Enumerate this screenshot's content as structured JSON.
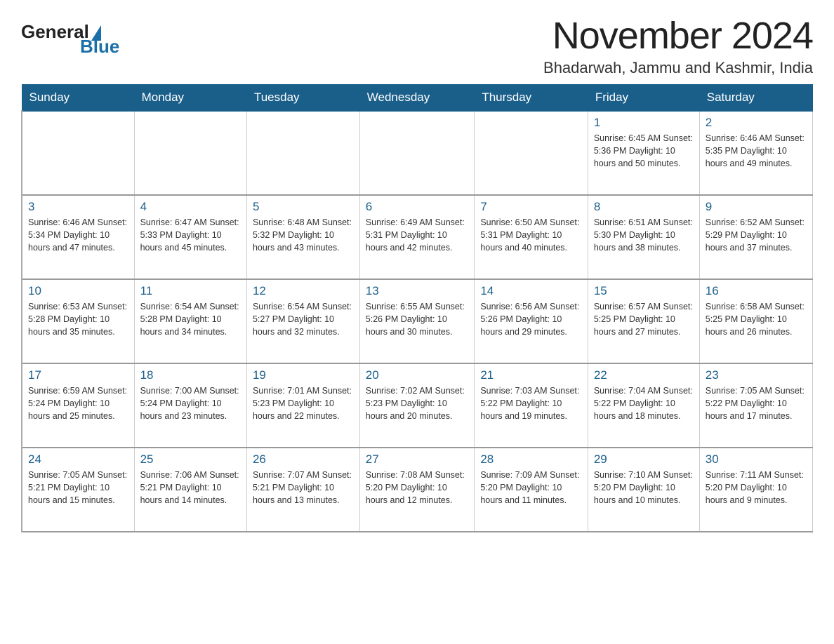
{
  "logo": {
    "general": "General",
    "blue": "Blue"
  },
  "header": {
    "month": "November 2024",
    "location": "Bhadarwah, Jammu and Kashmir, India"
  },
  "days_of_week": [
    "Sunday",
    "Monday",
    "Tuesday",
    "Wednesday",
    "Thursday",
    "Friday",
    "Saturday"
  ],
  "weeks": [
    [
      {
        "day": "",
        "info": ""
      },
      {
        "day": "",
        "info": ""
      },
      {
        "day": "",
        "info": ""
      },
      {
        "day": "",
        "info": ""
      },
      {
        "day": "",
        "info": ""
      },
      {
        "day": "1",
        "info": "Sunrise: 6:45 AM\nSunset: 5:36 PM\nDaylight: 10 hours and 50 minutes."
      },
      {
        "day": "2",
        "info": "Sunrise: 6:46 AM\nSunset: 5:35 PM\nDaylight: 10 hours and 49 minutes."
      }
    ],
    [
      {
        "day": "3",
        "info": "Sunrise: 6:46 AM\nSunset: 5:34 PM\nDaylight: 10 hours and 47 minutes."
      },
      {
        "day": "4",
        "info": "Sunrise: 6:47 AM\nSunset: 5:33 PM\nDaylight: 10 hours and 45 minutes."
      },
      {
        "day": "5",
        "info": "Sunrise: 6:48 AM\nSunset: 5:32 PM\nDaylight: 10 hours and 43 minutes."
      },
      {
        "day": "6",
        "info": "Sunrise: 6:49 AM\nSunset: 5:31 PM\nDaylight: 10 hours and 42 minutes."
      },
      {
        "day": "7",
        "info": "Sunrise: 6:50 AM\nSunset: 5:31 PM\nDaylight: 10 hours and 40 minutes."
      },
      {
        "day": "8",
        "info": "Sunrise: 6:51 AM\nSunset: 5:30 PM\nDaylight: 10 hours and 38 minutes."
      },
      {
        "day": "9",
        "info": "Sunrise: 6:52 AM\nSunset: 5:29 PM\nDaylight: 10 hours and 37 minutes."
      }
    ],
    [
      {
        "day": "10",
        "info": "Sunrise: 6:53 AM\nSunset: 5:28 PM\nDaylight: 10 hours and 35 minutes."
      },
      {
        "day": "11",
        "info": "Sunrise: 6:54 AM\nSunset: 5:28 PM\nDaylight: 10 hours and 34 minutes."
      },
      {
        "day": "12",
        "info": "Sunrise: 6:54 AM\nSunset: 5:27 PM\nDaylight: 10 hours and 32 minutes."
      },
      {
        "day": "13",
        "info": "Sunrise: 6:55 AM\nSunset: 5:26 PM\nDaylight: 10 hours and 30 minutes."
      },
      {
        "day": "14",
        "info": "Sunrise: 6:56 AM\nSunset: 5:26 PM\nDaylight: 10 hours and 29 minutes."
      },
      {
        "day": "15",
        "info": "Sunrise: 6:57 AM\nSunset: 5:25 PM\nDaylight: 10 hours and 27 minutes."
      },
      {
        "day": "16",
        "info": "Sunrise: 6:58 AM\nSunset: 5:25 PM\nDaylight: 10 hours and 26 minutes."
      }
    ],
    [
      {
        "day": "17",
        "info": "Sunrise: 6:59 AM\nSunset: 5:24 PM\nDaylight: 10 hours and 25 minutes."
      },
      {
        "day": "18",
        "info": "Sunrise: 7:00 AM\nSunset: 5:24 PM\nDaylight: 10 hours and 23 minutes."
      },
      {
        "day": "19",
        "info": "Sunrise: 7:01 AM\nSunset: 5:23 PM\nDaylight: 10 hours and 22 minutes."
      },
      {
        "day": "20",
        "info": "Sunrise: 7:02 AM\nSunset: 5:23 PM\nDaylight: 10 hours and 20 minutes."
      },
      {
        "day": "21",
        "info": "Sunrise: 7:03 AM\nSunset: 5:22 PM\nDaylight: 10 hours and 19 minutes."
      },
      {
        "day": "22",
        "info": "Sunrise: 7:04 AM\nSunset: 5:22 PM\nDaylight: 10 hours and 18 minutes."
      },
      {
        "day": "23",
        "info": "Sunrise: 7:05 AM\nSunset: 5:22 PM\nDaylight: 10 hours and 17 minutes."
      }
    ],
    [
      {
        "day": "24",
        "info": "Sunrise: 7:05 AM\nSunset: 5:21 PM\nDaylight: 10 hours and 15 minutes."
      },
      {
        "day": "25",
        "info": "Sunrise: 7:06 AM\nSunset: 5:21 PM\nDaylight: 10 hours and 14 minutes."
      },
      {
        "day": "26",
        "info": "Sunrise: 7:07 AM\nSunset: 5:21 PM\nDaylight: 10 hours and 13 minutes."
      },
      {
        "day": "27",
        "info": "Sunrise: 7:08 AM\nSunset: 5:20 PM\nDaylight: 10 hours and 12 minutes."
      },
      {
        "day": "28",
        "info": "Sunrise: 7:09 AM\nSunset: 5:20 PM\nDaylight: 10 hours and 11 minutes."
      },
      {
        "day": "29",
        "info": "Sunrise: 7:10 AM\nSunset: 5:20 PM\nDaylight: 10 hours and 10 minutes."
      },
      {
        "day": "30",
        "info": "Sunrise: 7:11 AM\nSunset: 5:20 PM\nDaylight: 10 hours and 9 minutes."
      }
    ]
  ]
}
